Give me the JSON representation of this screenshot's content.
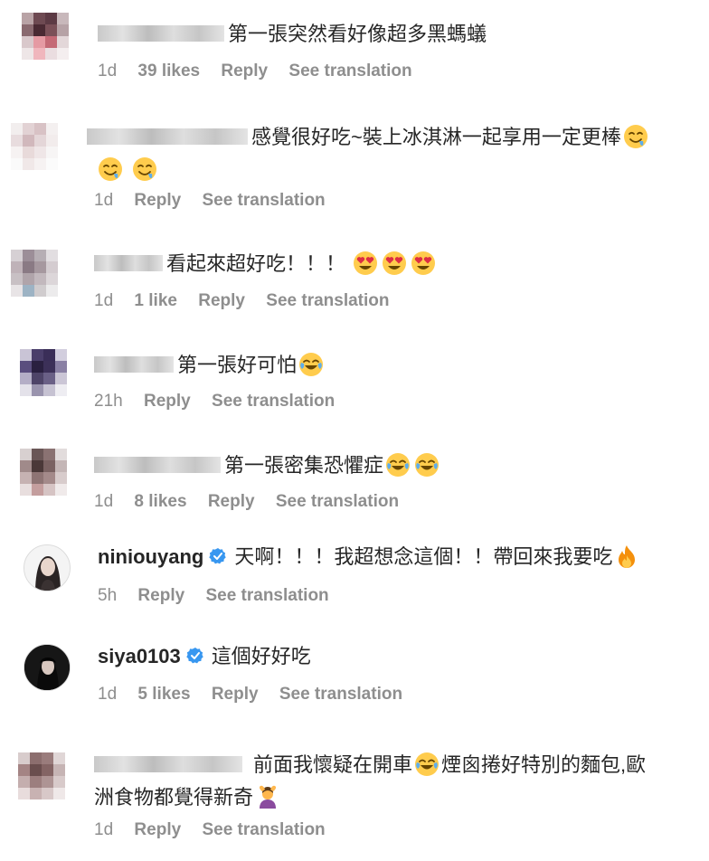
{
  "comments": [
    {
      "username": "",
      "username_blurred": true,
      "text": "第一張突然看好像超多黑螞蟻",
      "emojis": [],
      "time": "1d",
      "likes": "39 likes",
      "reply": "Reply",
      "translate": "See translation"
    },
    {
      "username": "",
      "username_blurred": true,
      "text": "感覺很好吃~裝上冰淇淋一起享用一定更棒",
      "emojis": [
        "drooling-face",
        "drooling-face",
        "drooling-face"
      ],
      "time": "1d",
      "likes": "",
      "reply": "Reply",
      "translate": "See translation"
    },
    {
      "username": "",
      "username_blurred": true,
      "text": "看起來超好吃！！！",
      "emojis": [
        "heart-eyes",
        "heart-eyes",
        "heart-eyes"
      ],
      "time": "1d",
      "likes": "1 like",
      "reply": "Reply",
      "translate": "See translation"
    },
    {
      "username": "",
      "username_blurred": true,
      "text": "第一張好可怕",
      "emojis": [
        "tears-of-joy"
      ],
      "time": "21h",
      "likes": "",
      "reply": "Reply",
      "translate": "See translation"
    },
    {
      "username": "",
      "username_blurred": true,
      "text": "第一張密集恐懼症",
      "emojis": [
        "tears-of-joy",
        "tears-of-joy"
      ],
      "time": "1d",
      "likes": "8 likes",
      "reply": "Reply",
      "translate": "See translation"
    },
    {
      "username": "niniouyang",
      "username_blurred": false,
      "verified": true,
      "text": "天啊！！！我超想念這個！！帶回來我要吃",
      "emojis": [
        "fire"
      ],
      "time": "5h",
      "likes": "",
      "reply": "Reply",
      "translate": "See translation"
    },
    {
      "username": "siya0103",
      "username_blurred": false,
      "verified": true,
      "text": "這個好好吃",
      "emojis": [],
      "time": "1d",
      "likes": "5 likes",
      "reply": "Reply",
      "translate": "See translation"
    },
    {
      "username": "",
      "username_blurred": true,
      "text_part1": "前面我懷疑在開車",
      "text_part2": "煙囪捲好特別的麵包,歐",
      "text_part3": "洲食物都覺得新奇",
      "emojis": [
        "tears-of-joy",
        "person-gesturing-ok"
      ],
      "time": "1d",
      "likes": "",
      "reply": "Reply",
      "translate": "See translation"
    }
  ],
  "colors": {
    "text": "#262626",
    "meta": "#8e8e8e",
    "verified": "#3897f0"
  }
}
